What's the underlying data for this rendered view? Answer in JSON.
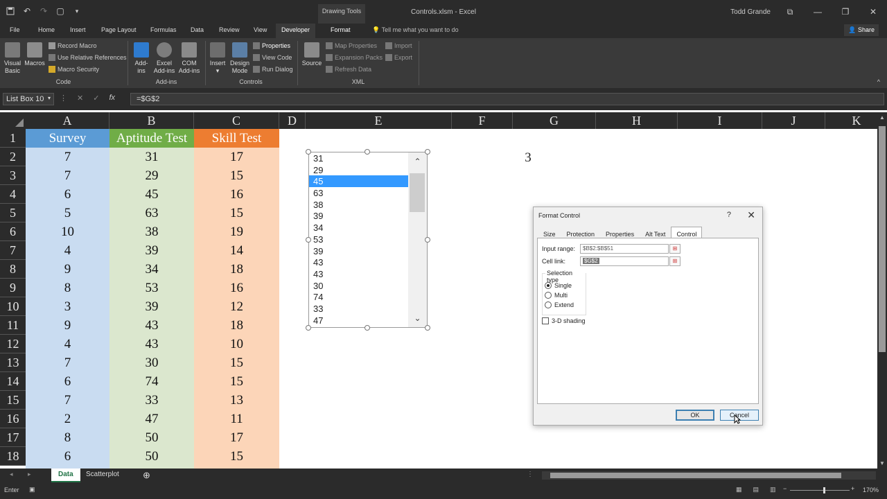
{
  "window": {
    "doc_title": "Controls.xlsm - Excel",
    "context_group": "Drawing Tools",
    "user": "Todd Grande"
  },
  "tabs": {
    "file": "File",
    "home": "Home",
    "insert": "Insert",
    "page_layout": "Page Layout",
    "formulas": "Formulas",
    "data": "Data",
    "review": "Review",
    "view": "View",
    "developer": "Developer",
    "format": "Format",
    "tell_me": "Tell me what you want to do",
    "share": "Share"
  },
  "ribbon": {
    "visual_basic": [
      "Visual",
      "Basic"
    ],
    "macros": "Macros",
    "record_macro": "Record Macro",
    "relative_refs": "Use Relative References",
    "macro_security": "Macro Security",
    "code_group": "Code",
    "addins": [
      "Add-",
      "ins"
    ],
    "excel_addins": [
      "Excel",
      "Add-ins"
    ],
    "com_addins": [
      "COM",
      "Add-ins"
    ],
    "addins_group": "Add-ins",
    "insert": "Insert",
    "design_mode": [
      "Design",
      "Mode"
    ],
    "properties": "Properties",
    "view_code": "View Code",
    "run_dialog": "Run Dialog",
    "controls_group": "Controls",
    "source": "Source",
    "map_properties": "Map Properties",
    "expansion_packs": "Expansion Packs",
    "refresh_data": "Refresh Data",
    "import": "Import",
    "export": "Export",
    "xml_group": "XML"
  },
  "formula_bar": {
    "name_box": "List Box 10",
    "formula": "=$G$2"
  },
  "columns": [
    "A",
    "B",
    "C",
    "D",
    "E",
    "F",
    "G",
    "H",
    "I",
    "J",
    "K"
  ],
  "rows": [
    "1",
    "2",
    "3",
    "4",
    "5",
    "6",
    "7",
    "8",
    "9",
    "10",
    "11",
    "12",
    "13",
    "14",
    "15",
    "16",
    "17",
    "18"
  ],
  "headers": [
    "Survey",
    "Aptitude Test",
    "Skill Test"
  ],
  "colors": {
    "survey_header": "#5b9bd5",
    "survey_fill": "#c9dcf1",
    "aptitude_header": "#70ad47",
    "aptitude_fill": "#dbe7ce",
    "skill_header": "#ed7d31",
    "skill_fill": "#fcd5b8"
  },
  "table": [
    [
      7,
      31,
      17
    ],
    [
      7,
      29,
      15
    ],
    [
      6,
      45,
      16
    ],
    [
      5,
      63,
      15
    ],
    [
      10,
      38,
      19
    ],
    [
      4,
      39,
      14
    ],
    [
      9,
      34,
      18
    ],
    [
      8,
      53,
      16
    ],
    [
      3,
      39,
      12
    ],
    [
      9,
      43,
      18
    ],
    [
      4,
      43,
      10
    ],
    [
      7,
      30,
      15
    ],
    [
      6,
      74,
      15
    ],
    [
      7,
      33,
      13
    ],
    [
      2,
      47,
      11
    ],
    [
      8,
      50,
      17
    ],
    [
      6,
      50,
      15
    ]
  ],
  "listbox": {
    "items": [
      "31",
      "29",
      "45",
      "63",
      "38",
      "39",
      "34",
      "53",
      "39",
      "43",
      "43",
      "30",
      "74",
      "33",
      "47"
    ],
    "selected_index": 2
  },
  "cell_g2": "3",
  "dialog": {
    "title": "Format Control",
    "help": "?",
    "tabs": [
      "Size",
      "Protection",
      "Properties",
      "Alt Text",
      "Control"
    ],
    "active_tab": "Control",
    "input_range_label": "Input range:",
    "input_range_value": "$B$2:$B$51",
    "cell_link_label": "Cell link:",
    "cell_link_value": "$G$2",
    "selection_type_label": "Selection type",
    "options": [
      "Single",
      "Multi",
      "Extend"
    ],
    "selected_option": "Single",
    "shading_label": "3-D shading",
    "ok": "OK",
    "cancel": "Cancel"
  },
  "sheets": [
    "Data",
    "Scatterplot"
  ],
  "active_sheet": "Data",
  "status": {
    "mode": "Enter",
    "zoom": "170%"
  }
}
